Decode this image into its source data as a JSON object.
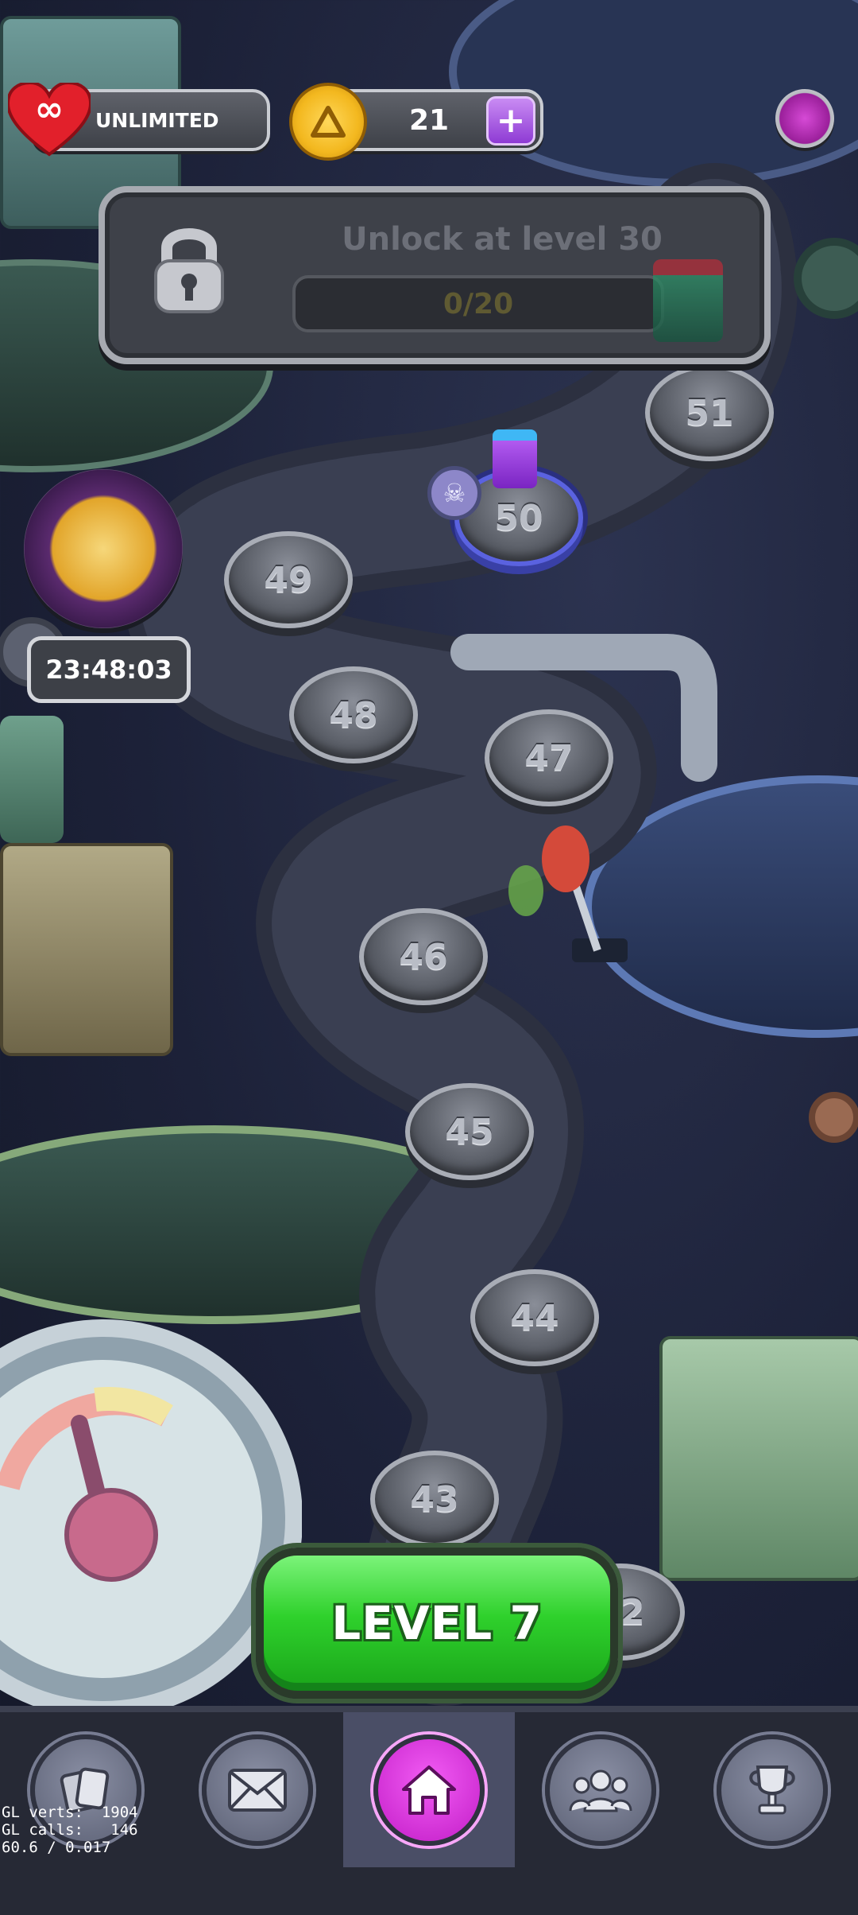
{
  "top_bar": {
    "lives_label": "UNLIMITED",
    "coins_value": "21",
    "plus_label": "+"
  },
  "lock_panel": {
    "title": "Unlock at level 30",
    "progress_text": "0/20"
  },
  "event_timer": "23:48:03",
  "level_nodes": [
    {
      "label": "51"
    },
    {
      "label": "50",
      "current": true
    },
    {
      "label": "49"
    },
    {
      "label": "48"
    },
    {
      "label": "47"
    },
    {
      "label": "46"
    },
    {
      "label": "45"
    },
    {
      "label": "44"
    },
    {
      "label": "43"
    },
    {
      "label": "42"
    }
  ],
  "play_button": "LEVEL 7",
  "nav": [
    {
      "icon": "cards-icon"
    },
    {
      "icon": "mail-icon"
    },
    {
      "icon": "home-icon",
      "active": true
    },
    {
      "icon": "team-icon"
    },
    {
      "icon": "trophy-icon"
    }
  ],
  "debug": {
    "line1": "GL verts:  1904",
    "line2": "GL calls:   146",
    "line3": "60.6 / 0.017"
  },
  "colors": {
    "accent_green": "#2fd12c",
    "accent_purple": "#c21dc7",
    "coin_gold": "#f3b81f",
    "heart_red": "#e2202b"
  }
}
